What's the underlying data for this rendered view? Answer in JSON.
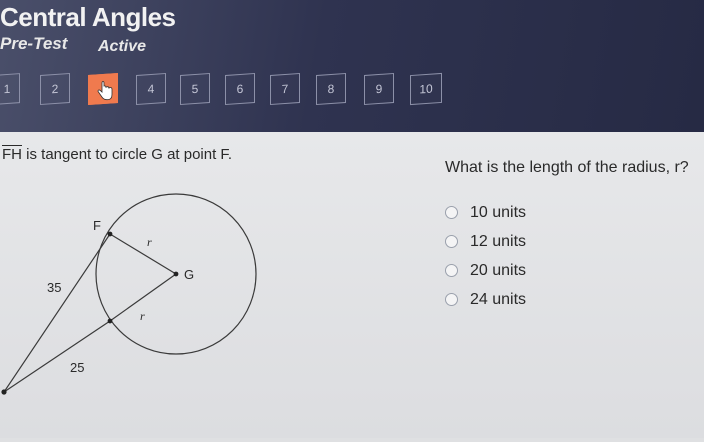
{
  "header": {
    "title": "Central Angles",
    "subtitle": "Pre-Test",
    "status": "Active"
  },
  "question_nav": [
    {
      "label": "1",
      "state": "normal"
    },
    {
      "label": "2",
      "state": "normal"
    },
    {
      "label": "3",
      "state": "current"
    },
    {
      "label": "4",
      "state": "normal"
    },
    {
      "label": "5",
      "state": "normal"
    },
    {
      "label": "6",
      "state": "normal"
    },
    {
      "label": "7",
      "state": "normal"
    },
    {
      "label": "8",
      "state": "normal"
    },
    {
      "label": "9",
      "state": "normal"
    },
    {
      "label": "10",
      "state": "normal"
    }
  ],
  "stem": {
    "segment": "FH",
    "text": " is tangent to circle G at point F."
  },
  "figure": {
    "point_f": "F",
    "point_g": "G",
    "radius_label_top": "r",
    "radius_label_bottom": "r",
    "length_35": "35",
    "length_25": "25"
  },
  "question": {
    "prompt": "What is the length of the radius, r?",
    "options": [
      "10 units",
      "12 units",
      "20 units",
      "24 units"
    ]
  },
  "colors": {
    "header": "#2f3350",
    "current": "#f07a4e",
    "background": "#dfe0e2"
  },
  "icons": {
    "current_marker": "hand-pointer-icon"
  }
}
